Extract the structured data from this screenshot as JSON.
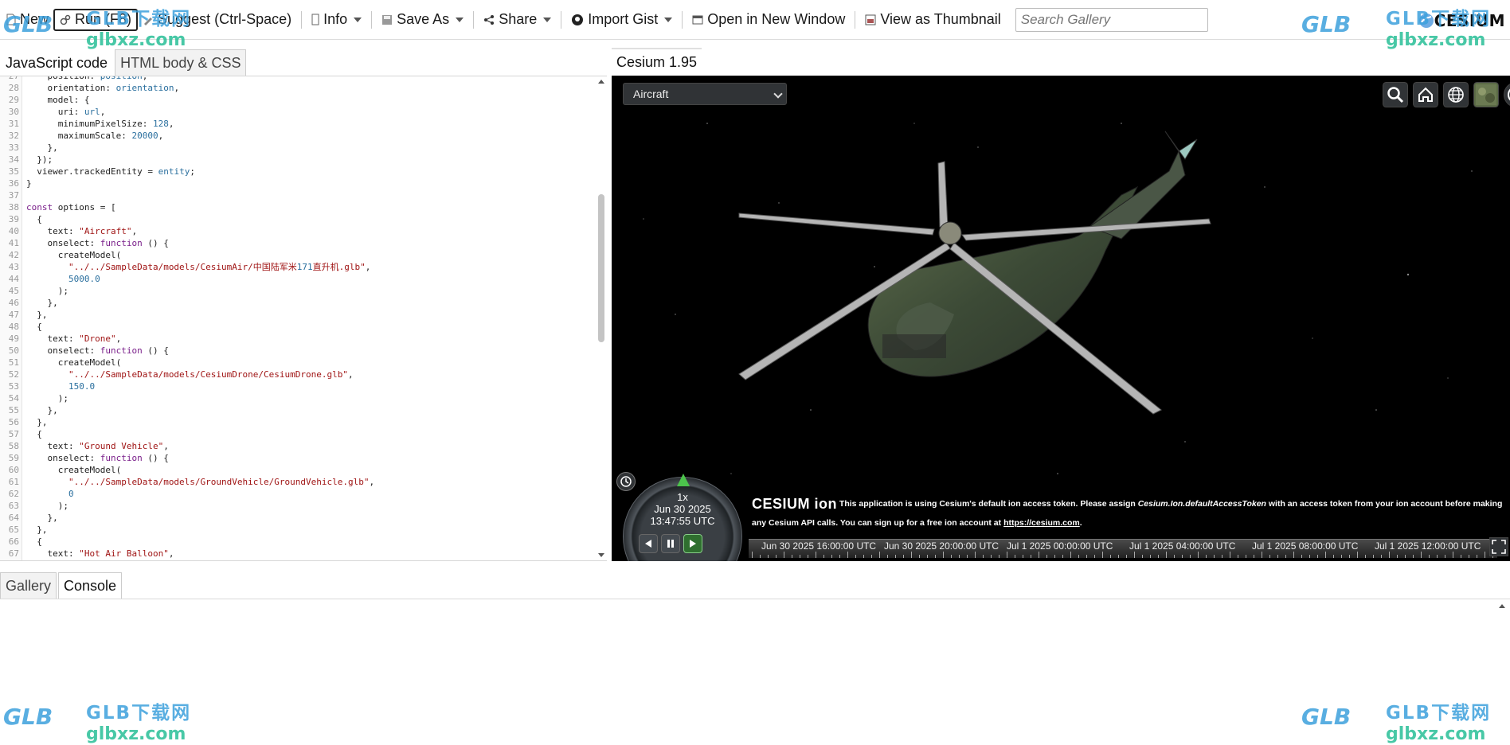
{
  "toolbar": {
    "new_label": "New",
    "run_label": "Run (F8)",
    "suggest_label": "Suggest (Ctrl-Space)",
    "info_label": "Info",
    "save_as_label": "Save As",
    "share_label": "Share",
    "import_gist_label": "Import Gist",
    "open_window_label": "Open in New Window",
    "thumbnail_label": "View as Thumbnail",
    "search_placeholder": "Search Gallery",
    "brand": "CESIUM"
  },
  "editor": {
    "tabs": [
      {
        "label": "JavaScript code"
      },
      {
        "label": "HTML body & CSS"
      }
    ],
    "lines": [
      {
        "n": "27",
        "t": "    position: position,"
      },
      {
        "n": "28",
        "t": "    orientation: orientation,"
      },
      {
        "n": "29",
        "t": "    model: {"
      },
      {
        "n": "30",
        "t": "      uri: url,"
      },
      {
        "n": "31",
        "t": "      minimumPixelSize: 128,"
      },
      {
        "n": "32",
        "t": "      maximumScale: 20000,"
      },
      {
        "n": "33",
        "t": "    },"
      },
      {
        "n": "34",
        "t": "  });"
      },
      {
        "n": "35",
        "t": "  viewer.trackedEntity = entity;"
      },
      {
        "n": "36",
        "t": "}"
      },
      {
        "n": "37",
        "t": ""
      },
      {
        "n": "38",
        "t": "const options = ["
      },
      {
        "n": "39",
        "t": "  {"
      },
      {
        "n": "40",
        "t": "    text: \"Aircraft\","
      },
      {
        "n": "41",
        "t": "    onselect: function () {"
      },
      {
        "n": "42",
        "t": "      createModel("
      },
      {
        "n": "43",
        "t": "        \"../../SampleData/models/CesiumAir/中国陆军米171直升机.glb\","
      },
      {
        "n": "44",
        "t": "        5000.0"
      },
      {
        "n": "45",
        "t": "      );"
      },
      {
        "n": "46",
        "t": "    },"
      },
      {
        "n": "47",
        "t": "  },"
      },
      {
        "n": "48",
        "t": "  {"
      },
      {
        "n": "49",
        "t": "    text: \"Drone\","
      },
      {
        "n": "50",
        "t": "    onselect: function () {"
      },
      {
        "n": "51",
        "t": "      createModel("
      },
      {
        "n": "52",
        "t": "        \"../../SampleData/models/CesiumDrone/CesiumDrone.glb\","
      },
      {
        "n": "53",
        "t": "        150.0"
      },
      {
        "n": "54",
        "t": "      );"
      },
      {
        "n": "55",
        "t": "    },"
      },
      {
        "n": "56",
        "t": "  },"
      },
      {
        "n": "57",
        "t": "  {"
      },
      {
        "n": "58",
        "t": "    text: \"Ground Vehicle\","
      },
      {
        "n": "59",
        "t": "    onselect: function () {"
      },
      {
        "n": "60",
        "t": "      createModel("
      },
      {
        "n": "61",
        "t": "        \"../../SampleData/models/GroundVehicle/GroundVehicle.glb\","
      },
      {
        "n": "62",
        "t": "        0"
      },
      {
        "n": "63",
        "t": "      );"
      },
      {
        "n": "64",
        "t": "    },"
      },
      {
        "n": "65",
        "t": "  },"
      },
      {
        "n": "66",
        "t": "  {"
      },
      {
        "n": "67",
        "t": "    text: \"Hot Air Balloon\","
      }
    ]
  },
  "viewer": {
    "tab_label": "Cesium 1.95",
    "model_select_value": "Aircraft",
    "animation": {
      "speed": "1x",
      "date": "Jun 30 2025",
      "time": "13:47:55 UTC"
    },
    "ion_logo": "CESIUM ion",
    "ion_message_pre": "This application is using Cesium's default ion access token. Please assign",
    "ion_message_token": "Cesium.Ion.defaultAccessToken",
    "ion_message_mid": "with an access token from your ion account before making any Cesium API calls. You can sign up for a free ion account at",
    "ion_link": "https://cesium.com",
    "ion_message_end": ".",
    "timeline_labels": [
      "Jun 30 2025 16:00:00 UTC",
      "Jun 30 2025 20:00:00 UTC",
      "Jul 1 2025 00:00:00 UTC",
      "Jul 1 2025 04:00:00 UTC",
      "Jul 1 2025 08:00:00 UTC",
      "Jul 1 2025 12:00:00 UTC"
    ]
  },
  "bottom": {
    "tabs": [
      {
        "label": "Gallery"
      },
      {
        "label": "Console"
      }
    ]
  },
  "watermark": {
    "glb": "GLB",
    "cn": "GLB下载网",
    "url": "glbxz.com"
  },
  "colors": {
    "accent_green": "#2f6f2f",
    "code_keyword": "#7a1f8a",
    "code_string": "#a01515",
    "watermark_blue": "#3ca0dc"
  }
}
